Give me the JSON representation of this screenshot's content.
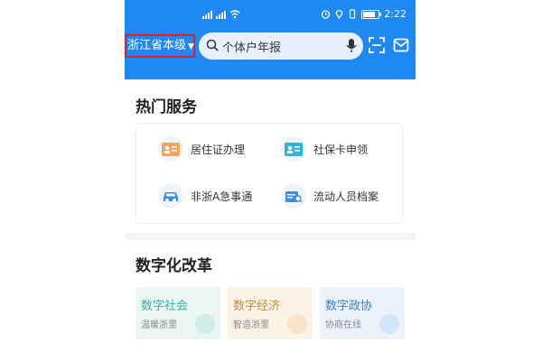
{
  "status_bar": {
    "time": "2:22"
  },
  "header": {
    "region": "浙江省本级",
    "search_placeholder": "个体户年报"
  },
  "hot_services": {
    "title": "热门服务",
    "items": [
      {
        "label": "居住证办理",
        "icon": "id-card-icon"
      },
      {
        "label": "社保卡申领",
        "icon": "social-security-card-icon"
      },
      {
        "label": "非浙A急事通",
        "icon": "car-icon"
      },
      {
        "label": "流动人员档案",
        "icon": "archive-icon"
      }
    ]
  },
  "digital_reform": {
    "title": "数字化改革",
    "tiles": [
      {
        "title": "数字社会",
        "subtitle": "温暖浙里",
        "color": "#3bb0a6"
      },
      {
        "title": "数字经济",
        "subtitle": "智造浙里",
        "color": "#c08a40"
      },
      {
        "title": "数字政协",
        "subtitle": "协商在线",
        "color": "#3a7fd0"
      }
    ]
  }
}
